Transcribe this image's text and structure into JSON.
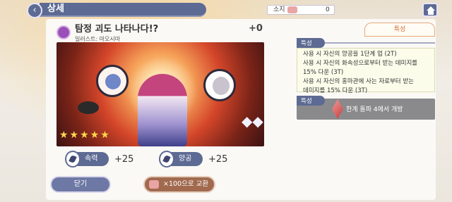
{
  "header": {
    "title": "상세",
    "owned_label": "소지",
    "owned_count": "0"
  },
  "card": {
    "name": "탐정 괴도 나타나다!?",
    "illustrator": "일러스트: 마오시마",
    "plus_level": "+0"
  },
  "stats": [
    {
      "label": "속력",
      "value": "+25"
    },
    {
      "label": "양공",
      "value": "+25"
    }
  ],
  "buttons": {
    "close": "닫기",
    "exchange": "×100으로 교환"
  },
  "right_panel": {
    "tab_label": "특성",
    "trait_header": "특성",
    "trait_lines": [
      "사용 시 자신의 양공을 1단계 업 (2T)",
      "사용 시 자신의 화속성으로부터 받는 데미지를",
      "15% 다운 (3T)",
      "사용 시 자신의 홍마관에 사는 자로부터 받는",
      "데미지를 15% 다운 (3T)"
    ],
    "ability_header": "특성",
    "ability_text": "한계 돌파 4에서 개방"
  },
  "colors": {
    "accent": "#5d6a93",
    "exchange": "#a16a4f",
    "tab_accent": "#d6723c"
  }
}
